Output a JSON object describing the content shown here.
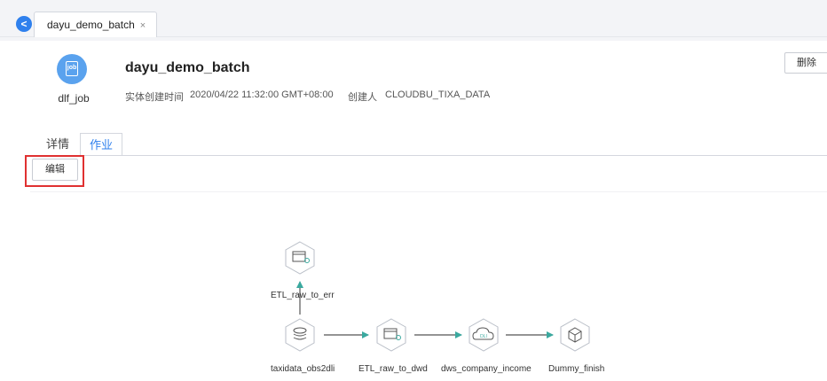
{
  "tab": {
    "title": "dayu_demo_batch",
    "close": "×"
  },
  "job": {
    "icon_text": "job",
    "type": "dlf_job",
    "title": "dayu_demo_batch",
    "created_time_label": "实体创建时间",
    "created_time": "2020/04/22 11:32:00 GMT+08:00",
    "creator_label": "创建人",
    "creator": "CLOUDBU_TIXA_DATA"
  },
  "actions": {
    "delete": "删除",
    "edit": "编辑"
  },
  "detail_tabs": {
    "details": "详情",
    "jobs": "作业"
  },
  "flow": {
    "nodes": [
      {
        "label": "ETL_raw_to_err",
        "icon": "etl-icon"
      },
      {
        "label": "taxidata_obs2dli",
        "icon": "stack-icon"
      },
      {
        "label": "ETL_raw_to_dwd",
        "icon": "etl-icon"
      },
      {
        "label": "dws_company_income",
        "icon": "dli-cloud-icon",
        "icon_text": "DLI"
      },
      {
        "label": "Dummy_finish",
        "icon": "cube-icon"
      }
    ]
  },
  "colors": {
    "accent": "#2f80ed",
    "highlight": "#e03131",
    "arrow": "#3aa99f"
  }
}
